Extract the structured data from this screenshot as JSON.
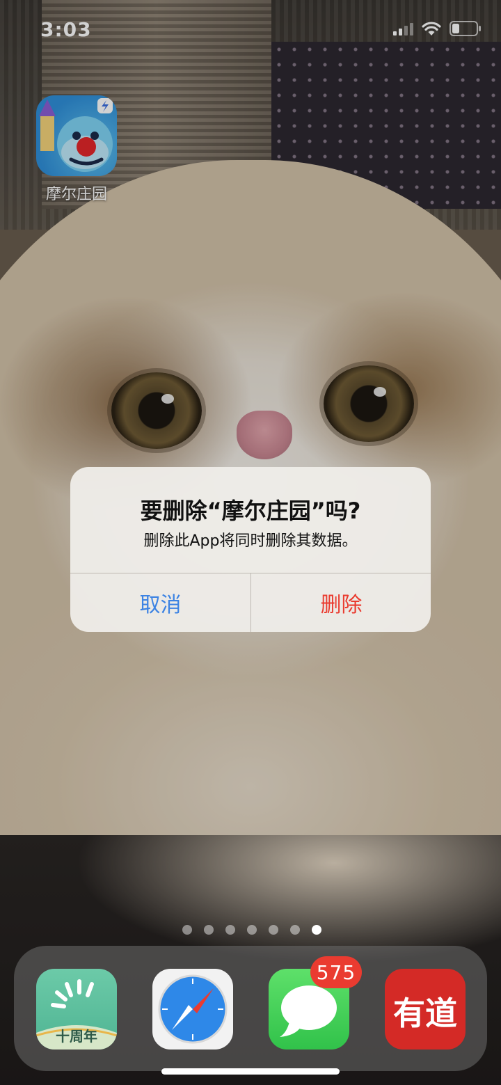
{
  "status_bar": {
    "time": "3:03",
    "signal_icon": "signal-icon",
    "wifi_icon": "wifi-icon",
    "battery_icon": "battery-icon"
  },
  "home": {
    "app": {
      "label": "摩尔庄园",
      "icon": "mole-manor-app-icon"
    }
  },
  "alert": {
    "title": "要删除“摩尔庄园”吗?",
    "message": "删除此App将同时删除其数据。",
    "cancel_label": "取消",
    "delete_label": "删除",
    "colors": {
      "cancel": "#3c83e3",
      "delete": "#ea3b2f"
    }
  },
  "page_dots": {
    "count": 7,
    "active_index": 6
  },
  "dock": {
    "apps": [
      {
        "name": "ten-year-app",
        "label": "十周年"
      },
      {
        "name": "safari-app"
      },
      {
        "name": "messages-app",
        "badge": "575"
      },
      {
        "name": "youdao-app",
        "label": "有道"
      }
    ]
  }
}
